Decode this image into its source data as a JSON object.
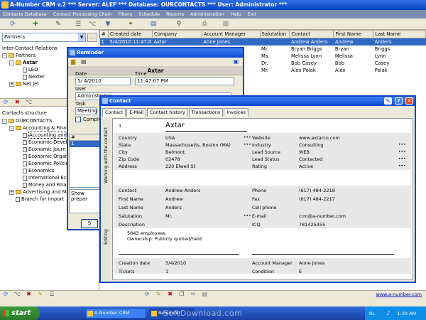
{
  "app": {
    "title": "A-Number CRM v.2 *** Server: ALEF *** Database: OURCONTACTS *** User: Administrator ***"
  },
  "menu": [
    "Contacts Database",
    "Contact Processing Chain",
    "Filters",
    "Schedule",
    "Reports",
    "Administration",
    "Help",
    "Exit"
  ],
  "left": {
    "combo_value": "Partners",
    "combo_btn": "...",
    "relations_label": "Inter-Contact Relations",
    "relations_tree": [
      {
        "label": "Partners",
        "level": 0,
        "kind": "folder",
        "exp": "-"
      },
      {
        "label": "Axtar",
        "level": 1,
        "kind": "folder",
        "exp": "-"
      },
      {
        "label": "LED",
        "level": 2,
        "kind": "doc"
      },
      {
        "label": "Nexter",
        "level": 2,
        "kind": "doc"
      },
      {
        "label": "Net Jet",
        "level": 1,
        "kind": "folder",
        "exp": "+"
      }
    ],
    "structure_label": "Contacts structure",
    "structure_tree": [
      {
        "label": "OURCONTACTS",
        "level": 0,
        "kind": "folder",
        "exp": "-"
      },
      {
        "label": "Accounting & Finan",
        "level": 1,
        "kind": "folder",
        "exp": "-"
      },
      {
        "label": "Accounting and",
        "level": 2,
        "kind": "doc"
      },
      {
        "label": "Economic Devel",
        "level": 2,
        "kind": "doc"
      },
      {
        "label": "Economic Journ",
        "level": 2,
        "kind": "doc"
      },
      {
        "label": "Economic Organ",
        "level": 2,
        "kind": "doc"
      },
      {
        "label": "Economic Policie",
        "level": 2,
        "kind": "doc"
      },
      {
        "label": "Economics",
        "level": 2,
        "kind": "doc"
      },
      {
        "label": "International Ec",
        "level": 2,
        "kind": "doc"
      },
      {
        "label": "Money and Finan",
        "level": 2,
        "kind": "doc"
      },
      {
        "label": "Advertising and Ma",
        "level": 1,
        "kind": "folder",
        "exp": "+"
      },
      {
        "label": "Branch for import",
        "level": 1,
        "kind": "doc"
      }
    ]
  },
  "grid": {
    "columns": [
      "#",
      "Created date",
      "Company",
      "Account Manager",
      "Salutation",
      "Contact",
      "First Name",
      "Last Name"
    ],
    "rows": [
      [
        "1",
        "5/4/2010 11:47:0",
        "Axtar",
        "Anne Jones",
        "",
        "Andrew Anders",
        "Andrew",
        "Anders"
      ],
      [
        "",
        "",
        "",
        "",
        "Mr.",
        "Bryan Briggs",
        "Bryan",
        "Briggs"
      ],
      [
        "",
        "",
        "",
        "",
        "Ms.",
        "Melissa Lynn",
        "Melissa",
        "Lynn"
      ],
      [
        "",
        "",
        "",
        "",
        "Dr.",
        "Bob Casey",
        "Bob",
        "Casey"
      ],
      [
        "",
        "",
        "",
        "",
        "Mr.",
        "Alex Polak",
        "Alex",
        "Polak"
      ]
    ]
  },
  "reminder": {
    "title": "Reminder",
    "header": "Axtar",
    "date_label": "Date",
    "date_value": "5/ 4/2010",
    "time_label": "Time",
    "time_value": "11:47:07 PM",
    "user_label": "User",
    "user_value": "Administrator",
    "task_label": "Task",
    "task_value": "Meeting",
    "complete_label": "Comple",
    "list_header": "#",
    "list_row": "1",
    "note": "Show prepar",
    "button_label": "S"
  },
  "contact": {
    "title": "Contact",
    "tabs": [
      "Contact",
      "E-Mail",
      "Contact history",
      "Transactions",
      "Invoices"
    ],
    "side_tabs": [
      "Working with the contact",
      "Editing"
    ],
    "id": "1",
    "name": "Axtar",
    "left_fields": [
      {
        "label": "Country",
        "value": "USA"
      },
      {
        "label": "State",
        "value": "Massachusetts, Boston (MA)"
      },
      {
        "label": "City",
        "value": "Belmont"
      },
      {
        "label": "Zip Code",
        "value": "02478"
      },
      {
        "label": "Address",
        "value": "220 Elwell St"
      }
    ],
    "right_fields": [
      {
        "label": "Website",
        "value": "www.axtarco.com"
      },
      {
        "label": "Industry",
        "value": "Consulting"
      },
      {
        "label": "Lead Source",
        "value": "WEB"
      },
      {
        "label": "Lead Status",
        "value": "Contacted"
      },
      {
        "label": "Rating",
        "value": "Active"
      }
    ],
    "person_left": [
      {
        "label": "Contact",
        "value": "Andrew Anders"
      },
      {
        "label": "First Name",
        "value": "Andrew"
      },
      {
        "label": "Last Name",
        "value": "Anders"
      },
      {
        "label": "Salutation",
        "value": "Mr."
      }
    ],
    "person_right": [
      {
        "label": "Phone",
        "value": "(617) 484-2218"
      },
      {
        "label": "Fax",
        "value": "(617) 484-2217"
      },
      {
        "label": "Cell phone",
        "value": ""
      },
      {
        "label": "E-mail",
        "value": "crm@a-number.com"
      }
    ],
    "description_label": "Description",
    "icq_label": "ICQ",
    "icq_value": "781425455",
    "description_lines": [
      "5843 employees",
      "Ownership: Publicly quoted/held"
    ],
    "created_label": "Creation date",
    "created_value": "5/4/2010",
    "tickets_label": "Tickets",
    "tickets_value": "1",
    "manager_label": "Account Manager",
    "manager_value": "Anne Jones",
    "condition_label": "Condition",
    "condition_value": "E"
  },
  "footer": {
    "link": "www.a-number.com"
  },
  "taskbar": {
    "start": "start",
    "tasks": [
      "A-Number CRM",
      "Reminder"
    ],
    "tray_lang": "RL",
    "tray_time": "1:39 AM"
  },
  "watermark": "SoftDownload.com"
}
